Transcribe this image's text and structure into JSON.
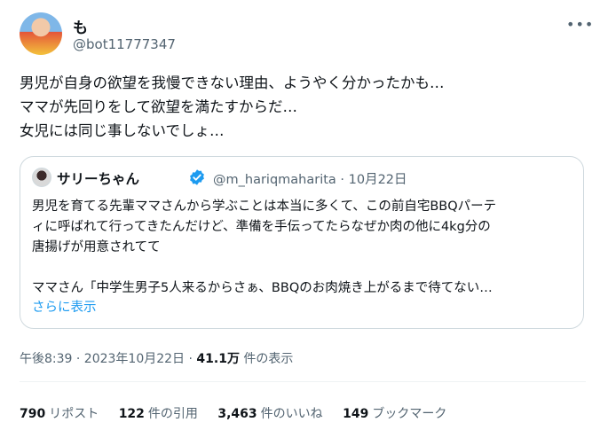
{
  "author": {
    "name": "も",
    "handle": "@bot11777347"
  },
  "tweet": {
    "lines": [
      "男児が自身の欲望を我慢できない理由、ようやく分かったかも…",
      "ママが先回りをして欲望を満たすからだ…",
      "女児には同じ事しないでしょ…"
    ]
  },
  "quote": {
    "name": "サリーちゃん",
    "handle": "@m_hariqmaharita",
    "date": "· 10月22日",
    "lines": [
      "男児を育てる先輩ママさんから学ぶことは本当に多くて、この前自宅BBQパーテ",
      "ィに呼ばれて行ってきたんだけど、準備を手伝ってたらなぜか肉の他に4kg分の",
      "唐揚げが用意されてて",
      "",
      "ママさん「中学生男子5人来るからさぁ、BBQのお肉焼き上がるまで待てない…"
    ],
    "show_more": "さらに表示",
    "verified_color": "#1d9bf0"
  },
  "meta": {
    "time": "午後8:39 · 2023年10月22日 · ",
    "views": "41.1万",
    "views_label": " 件の表示"
  },
  "stats": [
    {
      "count": "790",
      "label": "リポスト"
    },
    {
      "count": "122",
      "label": "件の引用"
    },
    {
      "count": "3,463",
      "label": "件のいいね"
    },
    {
      "count": "149",
      "label": "ブックマーク"
    }
  ]
}
